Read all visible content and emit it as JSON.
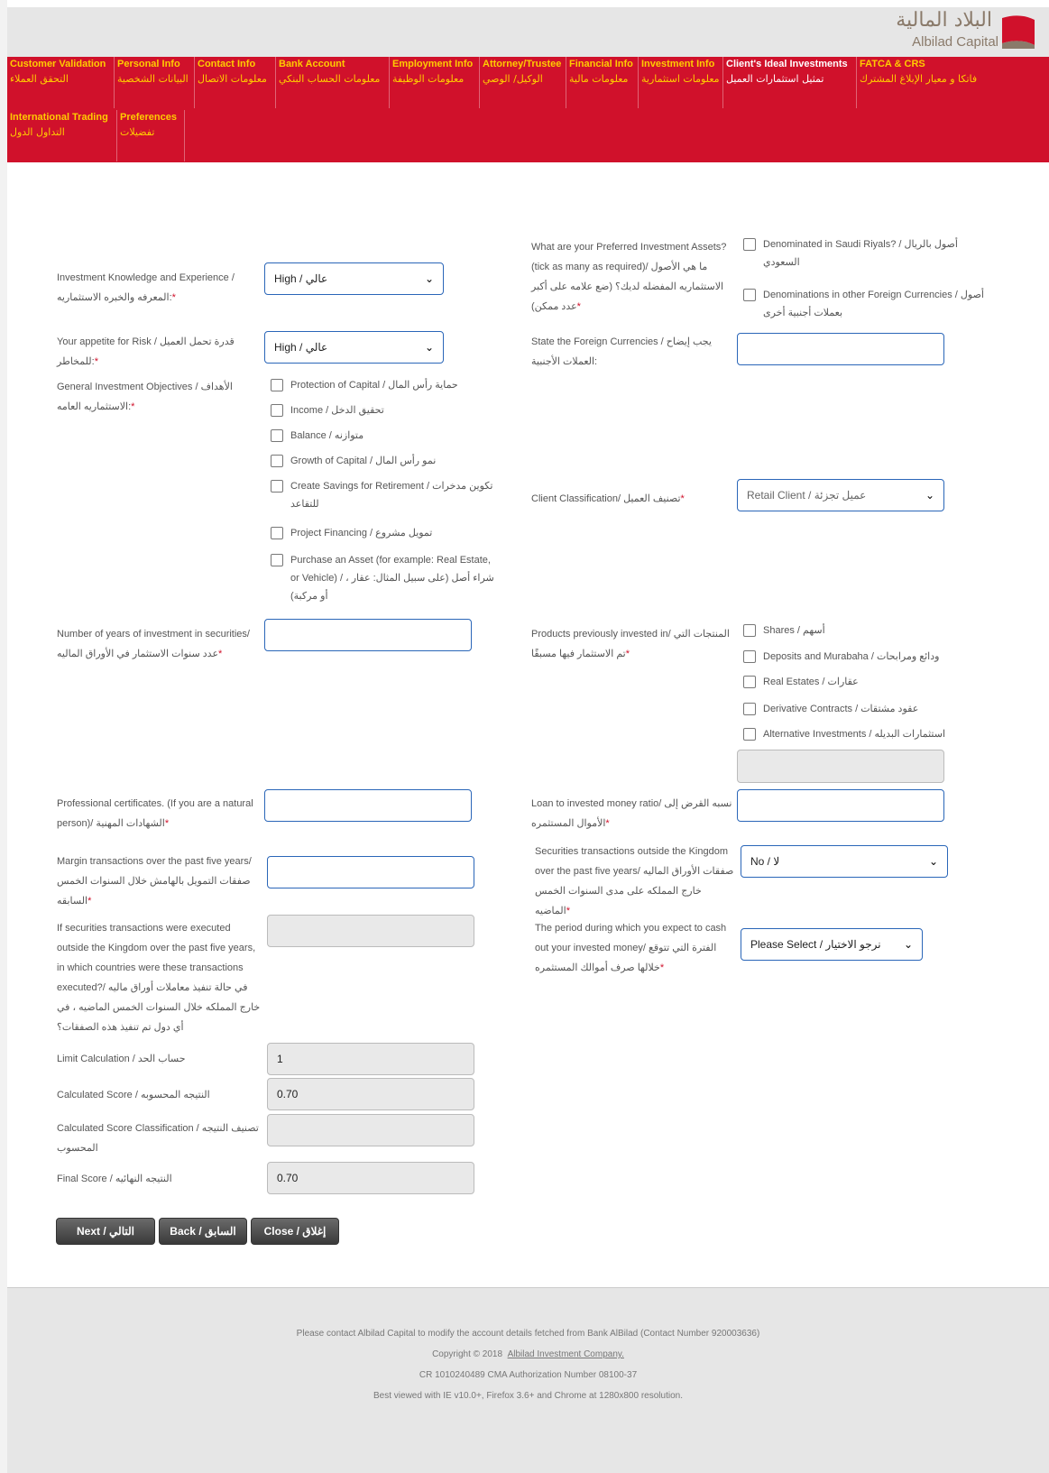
{
  "logo": {
    "arabic": "البلاد المالية",
    "english": "Albilad Capital"
  },
  "nav": {
    "row1": [
      {
        "en": "Customer Validation",
        "ar": "التحقق العملاء"
      },
      {
        "en": "Personal Info",
        "ar": "البيانات الشخصية"
      },
      {
        "en": "Contact Info",
        "ar": "معلومات الاتصال"
      },
      {
        "en": "Bank Account",
        "ar": "معلومات الحساب البنكي"
      },
      {
        "en": "Employment Info",
        "ar": "معلومات الوظيفة"
      },
      {
        "en": "Attorney/Trustee",
        "ar": "الوكيل/ الوصي"
      },
      {
        "en": "Financial Info",
        "ar": "معلومات مالية"
      },
      {
        "en": "Investment Info",
        "ar": "معلومات استثمارية"
      },
      {
        "en": "Client's Ideal Investments",
        "ar": "تمثيل استثمارات العميل"
      },
      {
        "en": "FATCA & CRS",
        "ar": "فاتكا و معيار الإبلاغ المشترك"
      }
    ],
    "row2": [
      {
        "en": "International Trading",
        "ar": "التداول الدول"
      },
      {
        "en": "Preferences",
        "ar": "تفضيلات"
      }
    ]
  },
  "form": {
    "knowledge": {
      "label": "Investment Knowledge and Experience / المعرفه والخبره الاستثماريه:",
      "value": "High / عالي"
    },
    "risk": {
      "label": "Your appetite for Risk / قدرة تحمل العميل للمخاطر:",
      "value": "High / عالي"
    },
    "objectives": {
      "label": "General Investment Objectives / الأهداف الاستثماريه العامه:",
      "options": [
        "Protection of Capital / حماية رأس المال",
        "Income / تحقيق الدخل",
        "Balance / متوازنه",
        "Growth of Capital / نمو رأس المال",
        "Create Savings for Retirement / تكوين مدخرات للتقاعد",
        "Project Financing / تمويل مشروع",
        "Purchase an Asset (for example: Real Estate, or Vehicle) / شراء أصل (على سبيل المثال: عقار ، أو مركبة)"
      ]
    },
    "preferred_assets": {
      "label": "What are your Preferred Investment Assets? (tick as many as required)/ ما هي الأصول الاستثماريه المفضله لديك؟ (ضع علامه على أكبر عدد ممكن)",
      "options": [
        "Denominated in Saudi Riyals? / أصول بالريال السعودي",
        "Denominations in other Foreign Currencies / أصول بعملات أجنبية أخرى"
      ]
    },
    "foreign_currencies": {
      "label": "State the Foreign Currencies / يجب إيضاح العملات الأجنبية:",
      "value": ""
    },
    "client_class": {
      "label": "Client Classification/ تصنيف العميل",
      "value": "Retail Client / عميل تجزئة"
    },
    "years": {
      "label": "Number of years of investment in securities/ عدد سنوات الاستثمار في الأوراق الماليه",
      "value": ""
    },
    "products": {
      "label": "Products previously invested in/ المنتجات التي تم الاستثمار فيها مسبقًا",
      "options": [
        "Shares / أسهم",
        "Deposits and Murabaha / ودائع ومرابحات",
        "Real Estates / عقارات",
        "Derivative Contracts / عقود مشتقات",
        "Alternative Investments / استثمارات البديله"
      ]
    },
    "certificates": {
      "label": "Professional certificates. (If you are a natural person)/ الشهادات المهنية",
      "value": ""
    },
    "loan_ratio": {
      "label": "Loan to invested money ratio/ نسبه القرض إلى الأموال المستثمره",
      "value": ""
    },
    "margin": {
      "label": "Margin transactions over the past five years/ صفقات التمويل بالهامش خلال السنوات الخمس السابقه",
      "value": ""
    },
    "outside_kingdom": {
      "label": "Securities transactions outside the Kingdom over the past five years/ صفقات الأوراق الماليه خارج المملكه على مدى السنوات الخمس الماضيه",
      "value": "No / لا"
    },
    "countries": {
      "label": "If securities transactions were executed outside the Kingdom over the past five years, in which countries were these transactions executed?/ في حالة تنفيذ معاملات أوراق ماليه خارج المملكه خلال السنوات الخمس الماضيه ، في أي دول تم تنفيذ هذه الصفقات؟",
      "value": ""
    },
    "cash_out": {
      "label": "The period during which you expect to cash out your invested money/ الفترة التي تتوقع خلالها صرف أموالك المستثمره",
      "value": "Please Select / نرجو الاختيار"
    },
    "limit": {
      "label": "Limit Calculation / حساب الحد",
      "value": "1"
    },
    "score": {
      "label": "Calculated Score / النتيجه المحسوبه",
      "value": "0.70"
    },
    "score_class": {
      "label": "Calculated Score Classification / تصنيف النتيجه المحسوب",
      "value": ""
    },
    "final": {
      "label": "Final Score / النتيجه النهائيه",
      "value": "0.70"
    }
  },
  "buttons": {
    "next": "Next / التالي",
    "back": "Back / السابق",
    "close": "Close / إغلاق"
  },
  "footer": {
    "contact": "Please contact Albilad Capital to modify the account details fetched from Bank AlBilad (Contact Number 920003636)",
    "copyright": "Copyright © 2018",
    "company_link": "Albilad Investment Company.",
    "cr": "CR 1010240489 CMA Authorization Number 08100-37",
    "browser": "Best viewed with IE v10.0+, Firefox 3.6+ and Chrome at 1280x800 resolution."
  },
  "colors": {
    "nav_bg": "#d0112b",
    "nav_text": "#ffcc00",
    "input_border": "#2a66b8"
  }
}
